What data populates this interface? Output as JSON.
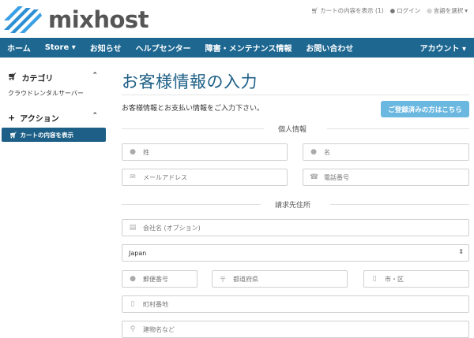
{
  "brand": {
    "name": "mixhost",
    "accent": "#1d6791",
    "logo_blue": "#2d8fd3"
  },
  "toplinks": {
    "cart": "カートの内容を表示 (1)",
    "login": "ログイン",
    "language": "言語を選択"
  },
  "nav": {
    "items": [
      "ホーム",
      "Store",
      "お知らせ",
      "ヘルプセンター",
      "障害・メンテナンス情報",
      "お問い合わせ"
    ],
    "account": "アカウント"
  },
  "sidebar": {
    "category_title": "カテゴリ",
    "category_link": "クラウドレンタルサーバー",
    "action_title": "アクション",
    "action_active": "カートの内容を表示"
  },
  "main": {
    "title": "お客様情報の入力",
    "intro": "お客様情報とお支払い情報をご入力下さい。",
    "login_button": "ご登録済みの方はこちら",
    "section_personal": "個人情報",
    "section_billing": "請求先住所",
    "fields": {
      "last_name": "姓",
      "first_name": "名",
      "email": "メールアドレス",
      "phone": "電話番号",
      "company": "会社名 (オプション)",
      "country": "Japan",
      "postcode": "郵便番号",
      "prefecture": "都道府県",
      "city": "市・区",
      "address1": "町村番地",
      "address2": "建物名など"
    }
  },
  "icons": [
    "cart-icon",
    "user-icon",
    "globe-icon",
    "caret-down-icon",
    "chevron-up-icon",
    "plus-icon",
    "envelope-icon",
    "phone-icon",
    "building-icon",
    "location-icon",
    "map-pin-icon"
  ]
}
